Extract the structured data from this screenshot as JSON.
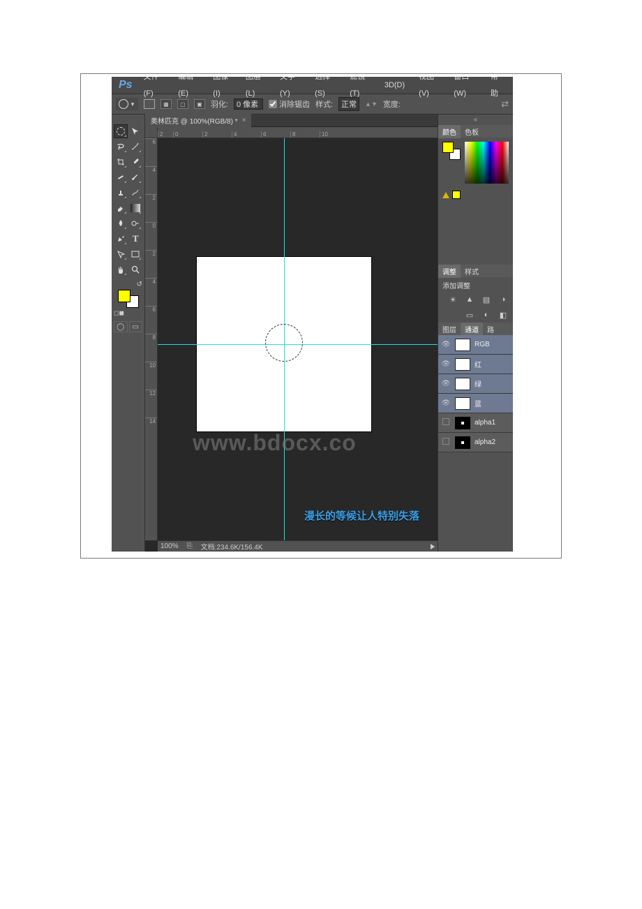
{
  "menu": {
    "app": "Ps",
    "items": [
      "文件(F)",
      "编辑(E)",
      "图像(I)",
      "图层(L)",
      "文字(Y)",
      "选择(S)",
      "滤镜(T)",
      "3D(D)",
      "视图(V)",
      "窗口(W)",
      "帮助"
    ]
  },
  "options": {
    "feather_label": "羽化:",
    "feather_value": "0 像素",
    "antialias": "消除锯齿",
    "style_label": "样式:",
    "style_value": "正常",
    "width_label": "宽度:"
  },
  "document": {
    "tab_title": "奥林匹克 @ 100%(RGB/8) *",
    "rulers_h": [
      "2",
      "0",
      "2",
      "4",
      "6",
      "8",
      "10"
    ],
    "rulers_v": [
      "6",
      "4",
      "2",
      "0",
      "2",
      "4",
      "6",
      "8",
      "10",
      "12",
      "14"
    ],
    "status_zoom": "100%",
    "status_doc": "文档:234.6K/156.4K",
    "caption": "漫长的等候让人特别失落",
    "watermark": "www.bdocx.co"
  },
  "panels": {
    "color_tabs": [
      "颜色",
      "色板"
    ],
    "adjust_tabs": [
      "调整",
      "样式"
    ],
    "adjust_add": "添加调整",
    "channel_tabs": [
      "图层",
      "通道",
      "路"
    ],
    "channels": [
      {
        "name": "RGB",
        "visible": true,
        "thumb": "white",
        "active": true
      },
      {
        "name": "红",
        "visible": true,
        "thumb": "white",
        "active": true
      },
      {
        "name": "绿",
        "visible": true,
        "thumb": "white",
        "active": true
      },
      {
        "name": "蓝",
        "visible": true,
        "thumb": "white",
        "active": true
      },
      {
        "name": "alpha1",
        "visible": false,
        "thumb": "alpha",
        "active": false
      },
      {
        "name": "alpha2",
        "visible": false,
        "thumb": "alpha",
        "active": false
      }
    ]
  }
}
